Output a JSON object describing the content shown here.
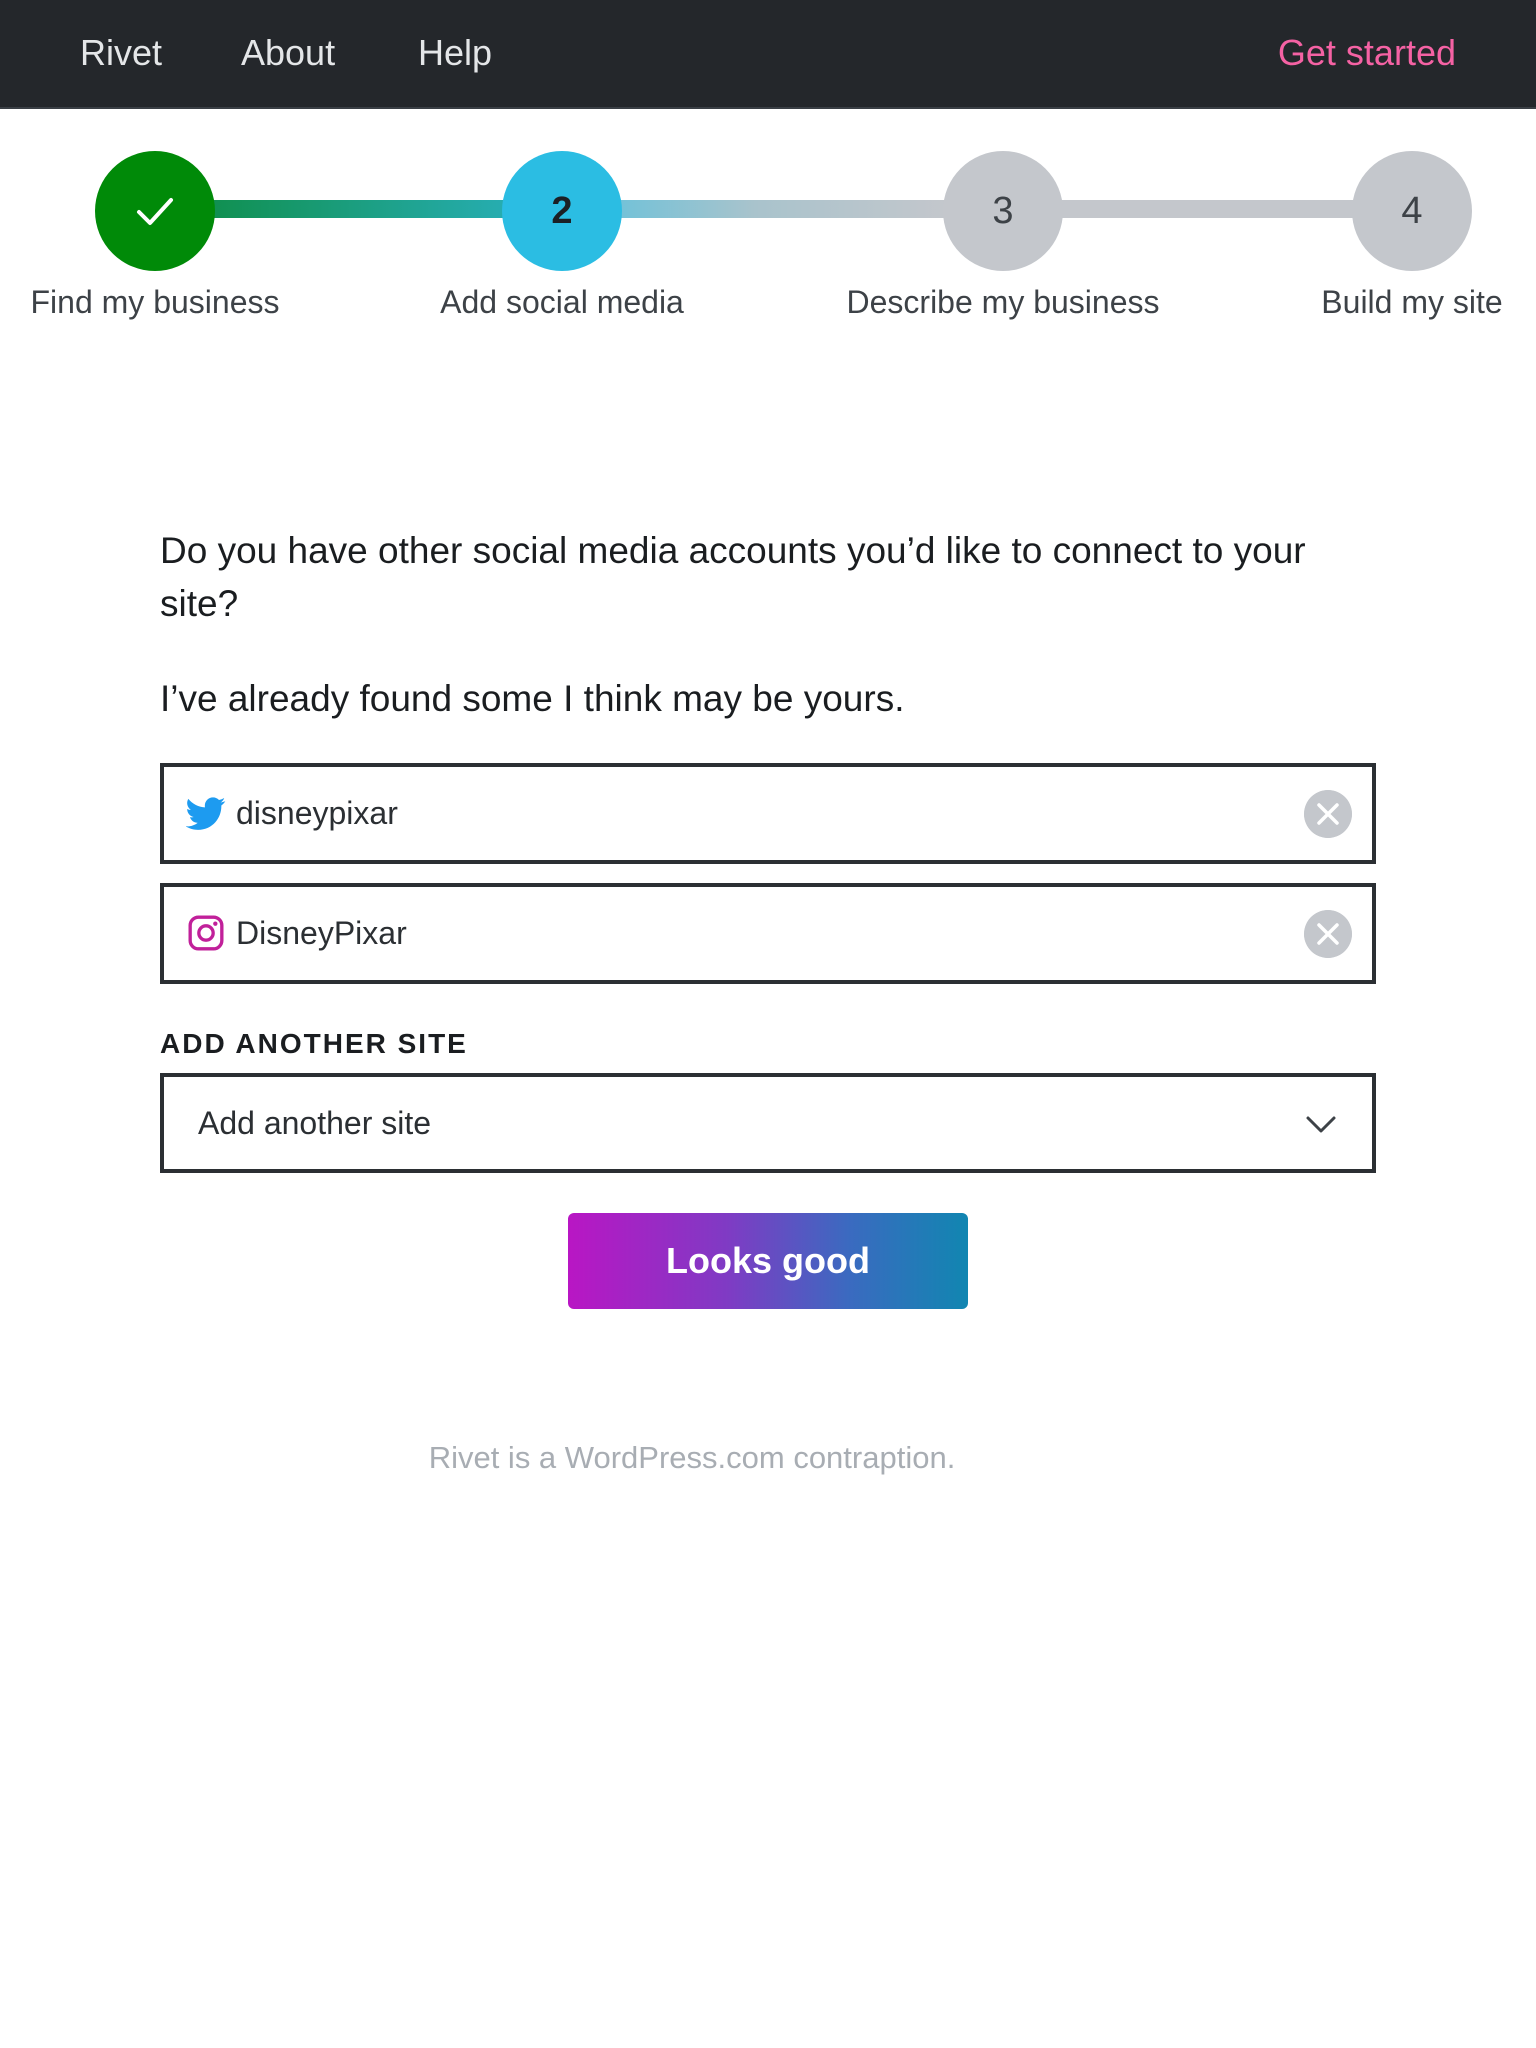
{
  "nav": {
    "brand": "Rivet",
    "about": "About",
    "help": "Help",
    "cta": "Get started"
  },
  "stepper": {
    "steps": [
      {
        "number": "",
        "label": "Find my business",
        "state": "complete"
      },
      {
        "number": "2",
        "label": "Add social media",
        "state": "current"
      },
      {
        "number": "3",
        "label": "Describe my business",
        "state": "upcoming"
      },
      {
        "number": "4",
        "label": "Build my site",
        "state": "upcoming"
      }
    ]
  },
  "main": {
    "question": "Do you have other social media accounts you’d like to connect to your site?",
    "subtext": "I’ve already found some I think may be yours.",
    "accounts": [
      {
        "network_icon": "twitter-icon",
        "value": "disneypixar"
      },
      {
        "network_icon": "instagram-icon",
        "value": "DisneyPixar"
      }
    ],
    "add_label": "ADD ANOTHER SITE",
    "add_select_value": "Add another site",
    "submit_label": "Looks good"
  },
  "footer": {
    "text": "Rivet is a WordPress.com contraption."
  },
  "colors": {
    "topbar": "#24272b",
    "cta": "#f562a4",
    "step_complete": "#008a08",
    "step_current": "#2bbde3",
    "step_upcoming": "#c4c7cc",
    "twitter": "#1d9bf0",
    "instagram": "#c1209a"
  }
}
